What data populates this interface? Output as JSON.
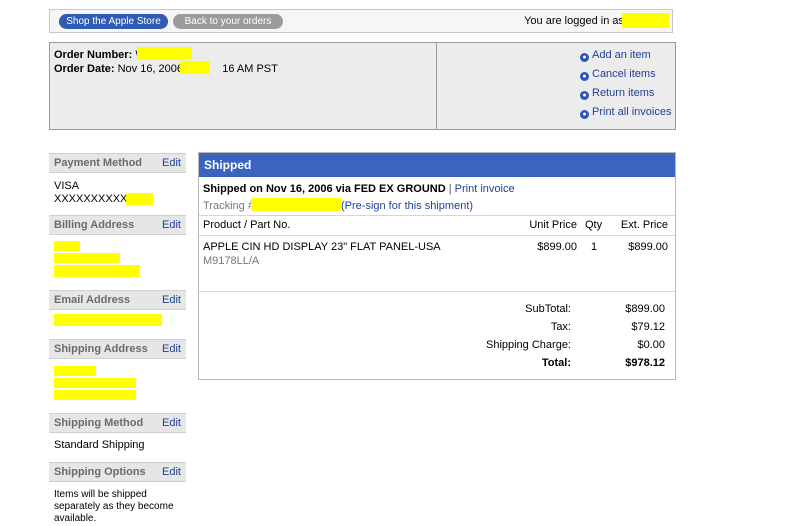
{
  "top_bar": {
    "shop_label": "Shop the Apple Store",
    "orders_label": "Back to your orders",
    "logged_in_text": "You are logged in as"
  },
  "order": {
    "number_label": "Order Number:",
    "number_value": "W",
    "date_label": "Order Date:",
    "date_value_prefix": "Nov 16, 2006 a",
    "date_value_suffix": "16 AM PST",
    "actions": [
      "Add an item",
      "Cancel items",
      "Return items",
      "Print all invoices"
    ]
  },
  "sidebar": {
    "payment": {
      "title": "Payment Method",
      "edit": "Edit",
      "lines": [
        "VISA",
        "XXXXXXXXXXX"
      ]
    },
    "billing": {
      "title": "Billing Address",
      "edit": "Edit"
    },
    "email": {
      "title": "Email Address",
      "edit": "Edit"
    },
    "shipping_address": {
      "title": "Shipping Address",
      "edit": "Edit"
    },
    "shipping_method": {
      "title": "Shipping Method",
      "edit": "Edit",
      "value": "Standard Shipping"
    },
    "shipping_options": {
      "title": "Shipping Options",
      "edit": "Edit",
      "lines": [
        "Items will be shipped",
        "separately as they become",
        "available."
      ]
    }
  },
  "shipment": {
    "status": "Shipped",
    "shipped_on": "Shipped on Nov 16, 2006 via FED EX GROUND",
    "separator": "|",
    "print_invoice": "Print invoice",
    "tracking_label": "Tracking #:",
    "presign": "(Pre-sign for this shipment)",
    "columns": {
      "product": "Product / Part No.",
      "unit_price": "Unit Price",
      "qty": "Qty",
      "ext_price": "Ext. Price"
    },
    "item": {
      "name": "APPLE CIN HD DISPLAY 23\" FLAT PANEL-USA",
      "part": "M9178LL/A",
      "unit_price": "$899.00",
      "qty": "1",
      "ext_price": "$899.00"
    },
    "totals": [
      {
        "label": "SubTotal:",
        "value": "$899.00"
      },
      {
        "label": "Tax:",
        "value": "$79.12"
      },
      {
        "label": "Shipping Charge:",
        "value": "$0.00"
      },
      {
        "label": "Total:",
        "value": "$978.12"
      }
    ]
  },
  "colors": {
    "header_blue": "#3a64bd",
    "link_blue": "#1f3f96",
    "redaction": "#ffff00"
  }
}
